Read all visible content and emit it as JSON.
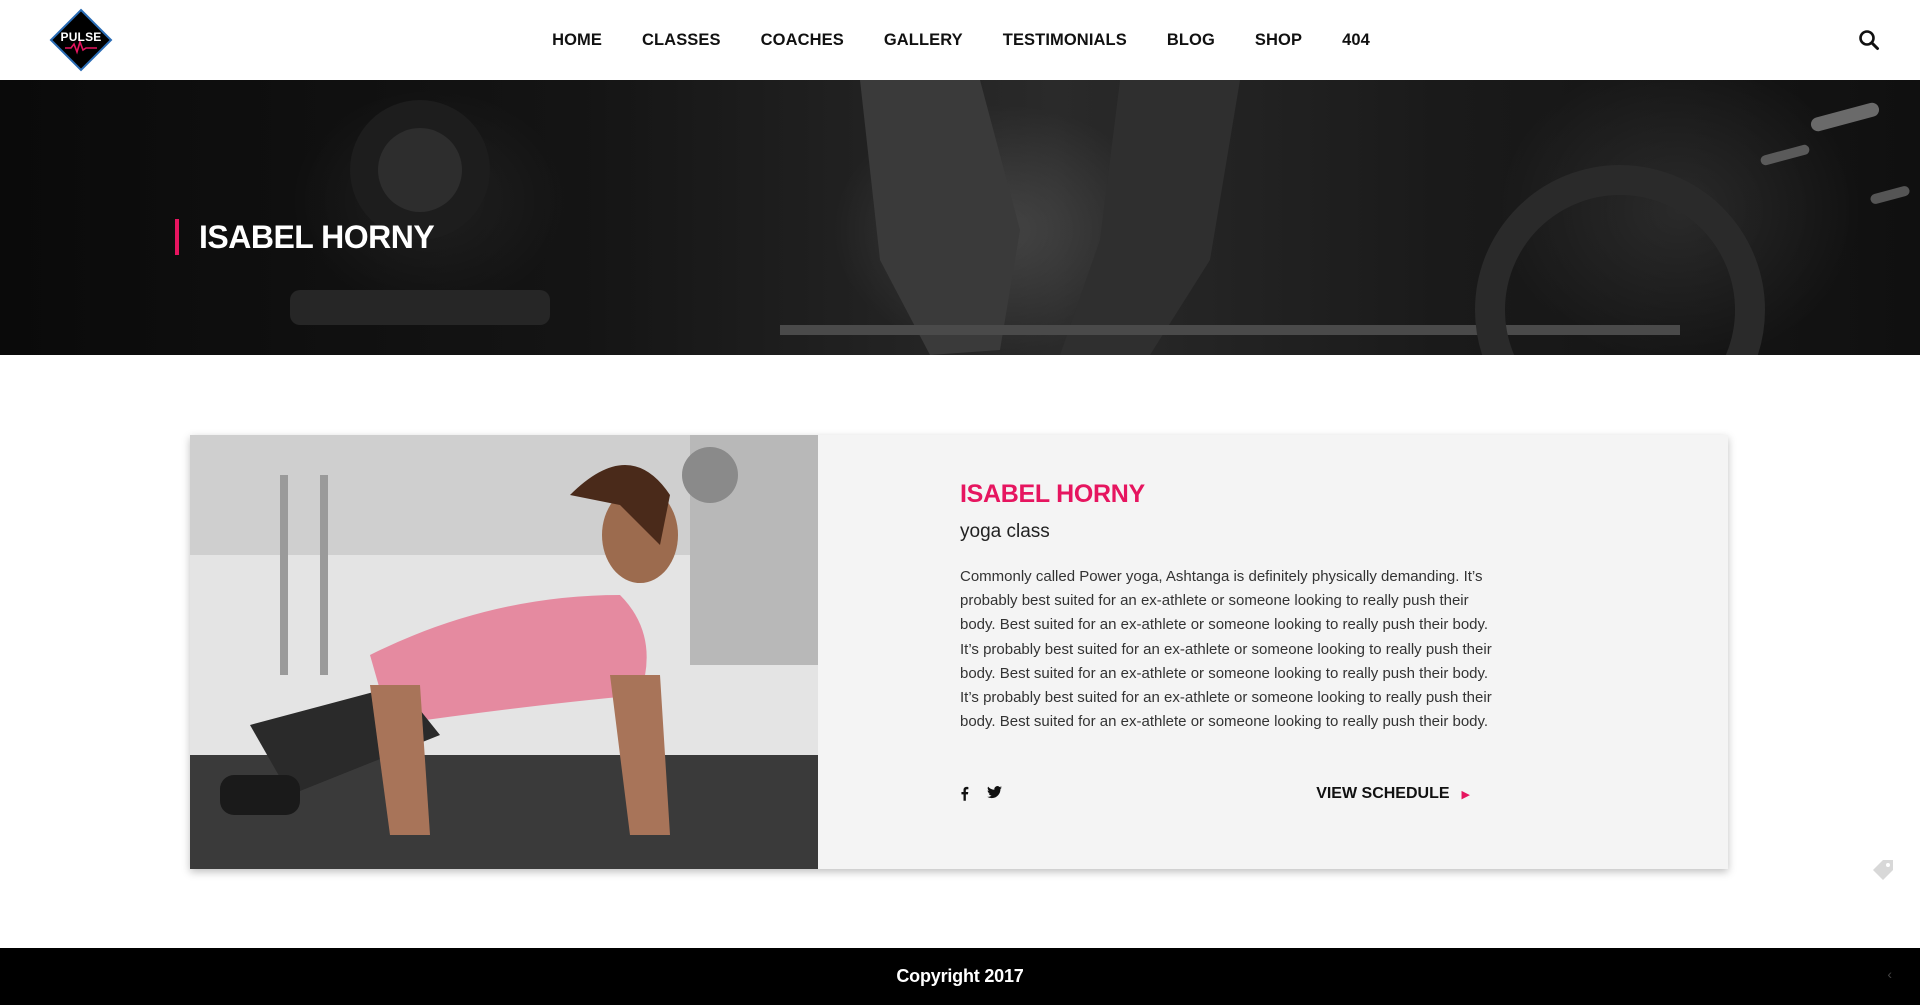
{
  "brand": {
    "logo_text": "PULSE",
    "accent": "#e6155f"
  },
  "nav": {
    "items": [
      "HOME",
      "CLASSES",
      "COACHES",
      "GALLERY",
      "TESTIMONIALS",
      "BLOG",
      "SHOP",
      "404"
    ],
    "search_icon": "search-icon"
  },
  "hero": {
    "title": "ISABEL HORNY"
  },
  "coach": {
    "name": "ISABEL HORNY",
    "class": "yoga class",
    "bio": "Commonly called Power yoga, Ashtanga is definitely physically demanding. It’s probably best suited for an ex-athlete or someone looking to really push their body. Best suited for an ex-athlete or someone looking to really push their body. It’s probably best suited for an ex-athlete or someone looking to really push their body. Best suited for an ex-athlete or someone looking to really push their body. It’s probably best suited for an ex-athlete or someone looking to really push their body. Best suited for an ex-athlete or someone looking to really push their body.",
    "social": [
      "facebook-icon",
      "twitter-icon"
    ],
    "view_schedule": "VIEW SCHEDULE"
  },
  "footer": {
    "copyright": "Copyright 2017"
  }
}
